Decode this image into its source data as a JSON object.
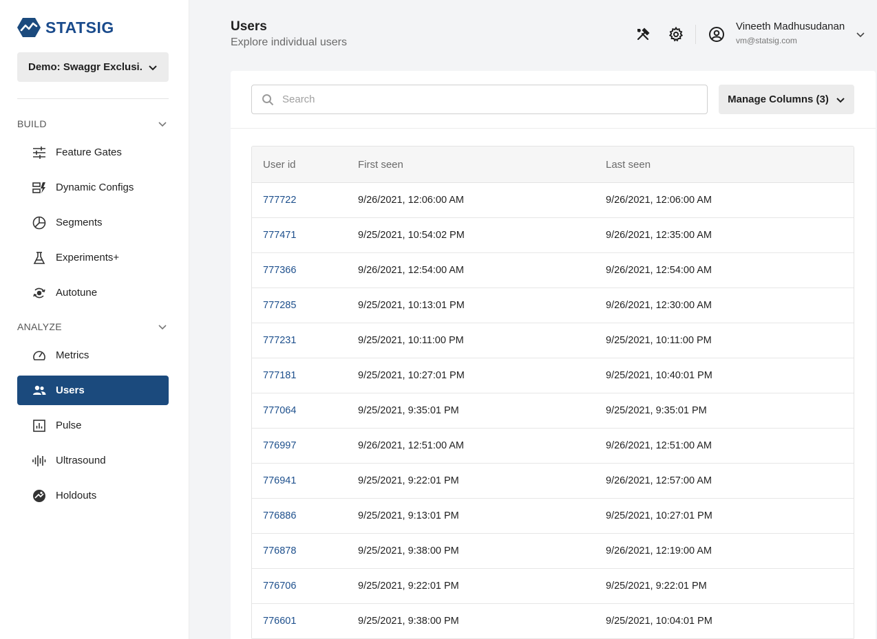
{
  "app": {
    "brand": "STATSIG",
    "accent": "#1b4a7d"
  },
  "project_selector": {
    "label": "Demo: Swaggr Exclusi..."
  },
  "sidebar": {
    "sections": [
      {
        "title": "BUILD"
      },
      {
        "title": "ANALYZE"
      }
    ],
    "items": [
      {
        "label": "Feature Gates",
        "icon": "sliders-icon"
      },
      {
        "label": "Dynamic Configs",
        "icon": "config-icon"
      },
      {
        "label": "Segments",
        "icon": "segments-icon"
      },
      {
        "label": "Experiments+",
        "icon": "flask-icon"
      },
      {
        "label": "Autotune",
        "icon": "autotune-icon"
      },
      {
        "label": "Metrics",
        "icon": "gauge-icon"
      },
      {
        "label": "Users",
        "icon": "users-icon",
        "active": true
      },
      {
        "label": "Pulse",
        "icon": "chart-icon"
      },
      {
        "label": "Ultrasound",
        "icon": "waveform-icon"
      },
      {
        "label": "Holdouts",
        "icon": "holdout-icon"
      }
    ]
  },
  "header": {
    "title": "Users",
    "subtitle": "Explore individual users",
    "user_name": "Vineeth Madhusudanan",
    "user_email": "vm@statsig.com"
  },
  "search": {
    "placeholder": "Search",
    "value": ""
  },
  "manage_columns": {
    "label": "Manage Columns (3)"
  },
  "table": {
    "columns": [
      "User id",
      "First seen",
      "Last seen"
    ],
    "rows": [
      [
        "777722",
        "9/26/2021, 12:06:00 AM",
        "9/26/2021, 12:06:00 AM"
      ],
      [
        "777471",
        "9/25/2021, 10:54:02 PM",
        "9/26/2021, 12:35:00 AM"
      ],
      [
        "777366",
        "9/26/2021, 12:54:00 AM",
        "9/26/2021, 12:54:00 AM"
      ],
      [
        "777285",
        "9/25/2021, 10:13:01 PM",
        "9/26/2021, 12:30:00 AM"
      ],
      [
        "777231",
        "9/25/2021, 10:11:00 PM",
        "9/25/2021, 10:11:00 PM"
      ],
      [
        "777181",
        "9/25/2021, 10:27:01 PM",
        "9/25/2021, 10:40:01 PM"
      ],
      [
        "777064",
        "9/25/2021, 9:35:01 PM",
        "9/25/2021, 9:35:01 PM"
      ],
      [
        "776997",
        "9/26/2021, 12:51:00 AM",
        "9/26/2021, 12:51:00 AM"
      ],
      [
        "776941",
        "9/25/2021, 9:22:01 PM",
        "9/26/2021, 12:57:00 AM"
      ],
      [
        "776886",
        "9/25/2021, 9:13:01 PM",
        "9/25/2021, 10:27:01 PM"
      ],
      [
        "776878",
        "9/25/2021, 9:38:00 PM",
        "9/26/2021, 12:19:00 AM"
      ],
      [
        "776706",
        "9/25/2021, 9:22:01 PM",
        "9/25/2021, 9:22:01 PM"
      ],
      [
        "776601",
        "9/25/2021, 9:38:00 PM",
        "9/25/2021, 10:04:01 PM"
      ]
    ]
  }
}
